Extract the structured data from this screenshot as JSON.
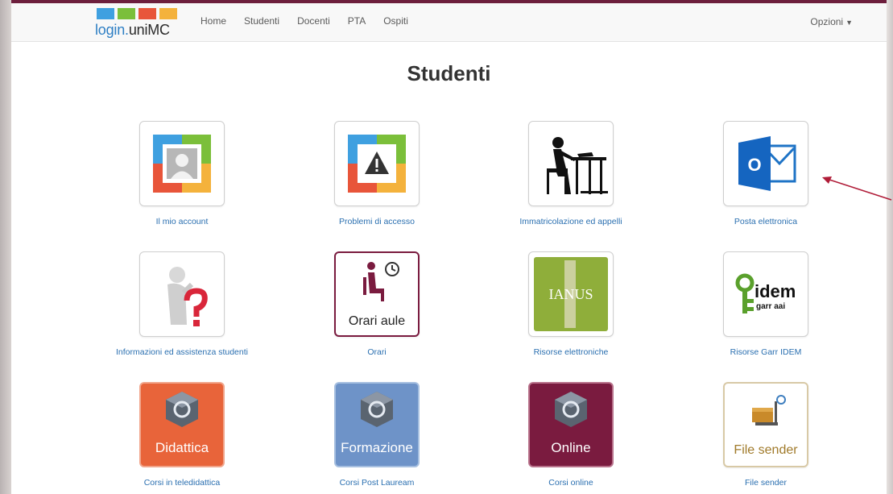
{
  "brand": {
    "prefix": "login.",
    "suffix": "uniMC",
    "colors": [
      "#3fa0e0",
      "#7bbf3a",
      "#e8553a",
      "#f4b23c"
    ]
  },
  "nav": {
    "items": [
      "Home",
      "Studenti",
      "Docenti",
      "PTA",
      "Ospiti"
    ],
    "options_label": "Opzioni"
  },
  "page_title": "Studenti",
  "tiles": [
    {
      "caption": "Il mio account",
      "icon": "user-account-icon"
    },
    {
      "caption": "Problemi di accesso",
      "icon": "warning-icon"
    },
    {
      "caption": "Immatricolazione ed appelli",
      "icon": "student-desk-icon"
    },
    {
      "caption": "Posta elettronica",
      "icon": "outlook-mail-icon"
    },
    {
      "caption": "Informazioni ed assistenza studenti",
      "icon": "question-person-icon"
    },
    {
      "caption": "Orari",
      "icon": "clock-seat-icon",
      "label": "Orari aule"
    },
    {
      "caption": "Risorse elettroniche",
      "icon": "ianus-icon",
      "label": "IANUS"
    },
    {
      "caption": "Risorse Garr IDEM",
      "icon": "idem-key-icon",
      "label": "idem",
      "sub": "garr aai"
    },
    {
      "caption": "Corsi in teledidattica",
      "icon": "moodle-cube-icon",
      "label": "Didattica",
      "color": "#e8643a"
    },
    {
      "caption": "Corsi Post Lauream",
      "icon": "moodle-cube-icon",
      "label": "Formazione",
      "color": "#6e93c8"
    },
    {
      "caption": "Corsi online",
      "icon": "moodle-cube-icon",
      "label": "Online",
      "color": "#7a1b3f"
    },
    {
      "caption": "File sender",
      "icon": "filesender-icon",
      "label": "File sender"
    }
  ]
}
